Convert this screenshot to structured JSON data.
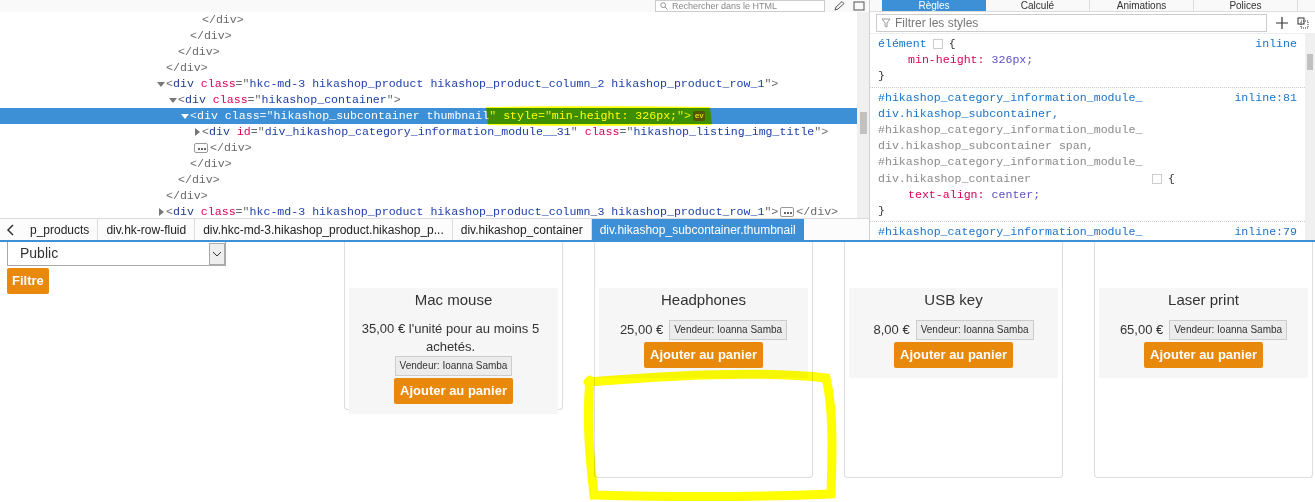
{
  "inspector": {
    "search": {
      "placeholder": "Rechercher dans le HTML"
    },
    "tree": [
      {
        "children": [
          {
            "children": [
              {
                "children": [
                  {
                    "close": "</div>"
                  }
                ],
                "close": "</div>"
              }
            ],
            "close": "</div>"
          }
        ],
        "close": "</div>"
      },
      {
        "open": [
          {
            "kind": "punct",
            "text": "<"
          },
          {
            "kind": "tag",
            "text": "div"
          },
          {
            "kind": "attr",
            "text": " class"
          },
          {
            "kind": "punct",
            "text": "=\""
          },
          {
            "kind": "value",
            "text": "hkc-md-3 hikashop_product hikashop_product_column_2 hikashop_product_row_1"
          },
          {
            "kind": "punct",
            "text": "\">"
          }
        ],
        "expanded": true,
        "selected": false,
        "close": "</div>",
        "children": [
          {
            "open": [
              {
                "kind": "punct",
                "text": "<"
              },
              {
                "kind": "tag",
                "text": "div"
              },
              {
                "kind": "attr",
                "text": " class"
              },
              {
                "kind": "punct",
                "text": "=\""
              },
              {
                "kind": "value",
                "text": "hikashop_container"
              },
              {
                "kind": "punct",
                "text": "\">"
              }
            ],
            "expanded": true,
            "selected": false,
            "close": "</div>",
            "children": [
              {
                "open": [
                  {
                    "kind": "punct",
                    "text": "<"
                  },
                  {
                    "kind": "tag",
                    "text": "div"
                  },
                  {
                    "kind": "attr",
                    "text": " class"
                  },
                  {
                    "kind": "punct",
                    "text": "=\""
                  },
                  {
                    "kind": "value",
                    "text": "hikashop_subcontainer thumbnail"
                  },
                  {
                    "kind": "punct",
                    "text": "\""
                  },
                  {
                    "kind": "attr",
                    "text": " style"
                  },
                  {
                    "kind": "punct",
                    "text": "=\""
                  },
                  {
                    "kind": "value",
                    "text": "min-height: 326px;"
                  },
                  {
                    "kind": "punct",
                    "text": "\">"
                  }
                ],
                "expanded": true,
                "selected": true,
                "badge": "ev",
                "close": "</div>",
                "children": [
                  {
                    "open": [
                      {
                        "kind": "punct",
                        "text": "<"
                      },
                      {
                        "kind": "tag",
                        "text": "div"
                      },
                      {
                        "kind": "attr",
                        "text": " id"
                      },
                      {
                        "kind": "punct",
                        "text": "=\""
                      },
                      {
                        "kind": "value",
                        "text": "div_hikashop_category_information_module__31"
                      },
                      {
                        "kind": "punct",
                        "text": "\""
                      },
                      {
                        "kind": "attr",
                        "text": " class"
                      },
                      {
                        "kind": "punct",
                        "text": "=\""
                      },
                      {
                        "kind": "value",
                        "text": "hikashop_listing_img_title"
                      },
                      {
                        "kind": "punct",
                        "text": "\">"
                      }
                    ],
                    "expanded": false,
                    "selected": false,
                    "close": "</div>"
                  }
                ]
              }
            ]
          }
        ]
      },
      {
        "open": [
          {
            "kind": "punct",
            "text": "<"
          },
          {
            "kind": "tag",
            "text": "div"
          },
          {
            "kind": "attr",
            "text": " class"
          },
          {
            "kind": "punct",
            "text": "=\""
          },
          {
            "kind": "value",
            "text": "hkc-md-3 hikashop_product hikashop_product_column_3 hikashop_product_row_1"
          },
          {
            "kind": "punct",
            "text": "\">"
          }
        ],
        "expanded": false,
        "selected": false,
        "close": "</div>"
      }
    ],
    "breadcrumbs": [
      {
        "label": "p_products",
        "selected": false
      },
      {
        "label": "div.hk-row-fluid",
        "selected": false
      },
      {
        "label": "div.hkc-md-3.hikashop_product.hikashop_p...",
        "selected": false
      },
      {
        "label": "div.hikashop_container",
        "selected": false
      },
      {
        "label": "div.hikashop_subcontainer.thumbnail",
        "selected": true
      }
    ]
  },
  "styles": {
    "tabs": [
      {
        "label": "Règles",
        "selected": true
      },
      {
        "label": "Calculé",
        "selected": false
      },
      {
        "label": "Animations",
        "selected": false
      },
      {
        "label": "Polices",
        "selected": false
      }
    ],
    "filter": {
      "placeholder": "Filtrer les styles"
    },
    "rules": [
      {
        "selectors": [
          {
            "text": "élément",
            "matched": true
          }
        ],
        "open_brace": "{",
        "source": "inline",
        "declarations": [
          {
            "property": "min-height:",
            "value": "326px;"
          }
        ],
        "close_brace": "}"
      },
      {
        "selectors": [
          {
            "text": "#hikashop_category_information_module_ div.hikashop_subcontainer,",
            "matched": true
          },
          {
            "text": "#hikashop_category_information_module_ div.hikashop_subcontainer span,",
            "matched": false
          },
          {
            "text": "#hikashop_category_information_module_ div.hikashop_container",
            "matched": false
          }
        ],
        "open_brace": "{",
        "source": "inline:81",
        "declarations": [
          {
            "property": "text-align:",
            "value": "center;"
          }
        ],
        "close_brace": "}"
      },
      {
        "selectors": [
          {
            "text": "#hikashop_category_information_module_",
            "matched": true
          }
        ],
        "source": "inline:79"
      }
    ]
  },
  "page": {
    "filter": {
      "select": "Public",
      "button": "Filtre"
    },
    "products": [
      {
        "name": "Mac mouse",
        "price": "35,00 € l'unité pour au moins 5 achetés.",
        "vendor": "Vendeur: Ioanna Samba",
        "button": "Ajouter au panier"
      },
      {
        "name": "Headphones",
        "price": "25,00 €",
        "vendor": "Vendeur: Ioanna Samba",
        "button": "Ajouter au panier"
      },
      {
        "name": "USB key",
        "price": "8,00 €",
        "vendor": "Vendeur: Ioanna Samba",
        "button": "Ajouter au panier"
      },
      {
        "name": "Laser print",
        "price": "65,00 €",
        "vendor": "Vendeur: Ioanna Samba",
        "button": "Ajouter au panier"
      }
    ]
  }
}
